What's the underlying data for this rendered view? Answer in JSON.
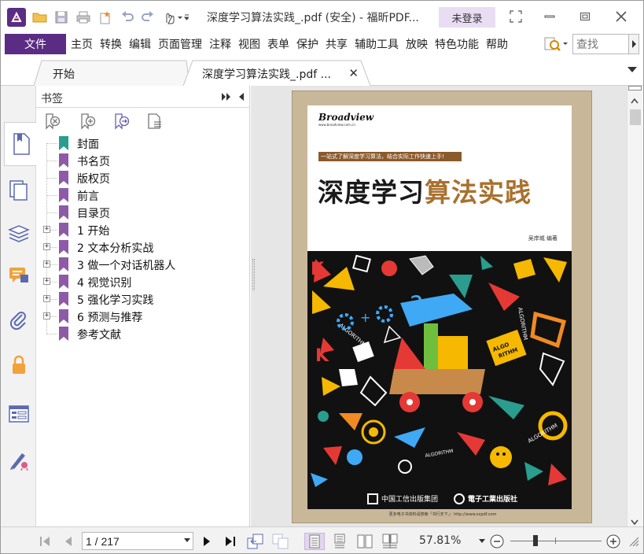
{
  "window": {
    "title": "深度学习算法实践_.pdf (安全) - 福昕PDF...",
    "login_label": "未登录"
  },
  "menu": {
    "file_label": "文件",
    "items": [
      "主页",
      "转换",
      "编辑",
      "页面管理",
      "注释",
      "视图",
      "表单",
      "保护",
      "共享",
      "辅助工具",
      "放映",
      "特色功能",
      "帮助"
    ],
    "search_placeholder": "查找"
  },
  "tabs": [
    {
      "label": "开始"
    },
    {
      "label": "深度学习算法实践_.pdf ..."
    }
  ],
  "rail_icons": [
    "bookmark-panel-icon",
    "pages-panel-icon",
    "layers-panel-icon",
    "comments-panel-icon",
    "attachments-panel-icon",
    "security-panel-icon",
    "form-fields-panel-icon",
    "signatures-panel-icon"
  ],
  "bookmarks_panel": {
    "title": "书签",
    "tools": [
      "delete-bookmark-icon",
      "add-bookmark-icon",
      "bookmark-options-icon",
      "bookmark-properties-icon"
    ],
    "items": [
      {
        "label": "封面",
        "expandable": false,
        "color": "#2a9d8f"
      },
      {
        "label": "书名页",
        "expandable": false,
        "color": "#8e5aa8"
      },
      {
        "label": "版权页",
        "expandable": false,
        "color": "#8e5aa8"
      },
      {
        "label": "前言",
        "expandable": false,
        "color": "#8e5aa8"
      },
      {
        "label": "目录页",
        "expandable": false,
        "color": "#8e5aa8"
      },
      {
        "label": "1  开始",
        "expandable": true,
        "color": "#8e5aa8"
      },
      {
        "label": "2  文本分析实战",
        "expandable": true,
        "color": "#8e5aa8"
      },
      {
        "label": "3  做一个对话机器人",
        "expandable": true,
        "color": "#8e5aa8"
      },
      {
        "label": "4  视觉识别",
        "expandable": true,
        "color": "#8e5aa8"
      },
      {
        "label": "5  强化学习实践",
        "expandable": true,
        "color": "#8e5aa8"
      },
      {
        "label": "6  预测与推荐",
        "expandable": true,
        "color": "#8e5aa8"
      },
      {
        "label": "参考文献",
        "expandable": false,
        "color": "#8e5aa8"
      }
    ]
  },
  "cover": {
    "publisher_logo": "Broadview",
    "publisher_url": "www.broadview.com.cn",
    "tagline": "一站式了解深度学习算法，结合实际工作快速上手!",
    "title_part1": "深度学习",
    "title_part2": "算法实践",
    "author": "吴岸城  编著",
    "publisher1": "中国工信出版集团",
    "publisher2": "電子工業出版社",
    "footer": "更多电子书资料请搜索「书行天下」：http://www.sxpdf.com",
    "art_words": [
      "ALGORITHM",
      "ALGO",
      "RITHM",
      "ALGORITHM",
      "ALGORITHM"
    ]
  },
  "status": {
    "page_value": "1 / 217",
    "zoom": "57.81%"
  },
  "colors": {
    "brand": "#5b2c83",
    "login_bg": "#e9ddf3",
    "cover_brown": "#a9712f"
  }
}
